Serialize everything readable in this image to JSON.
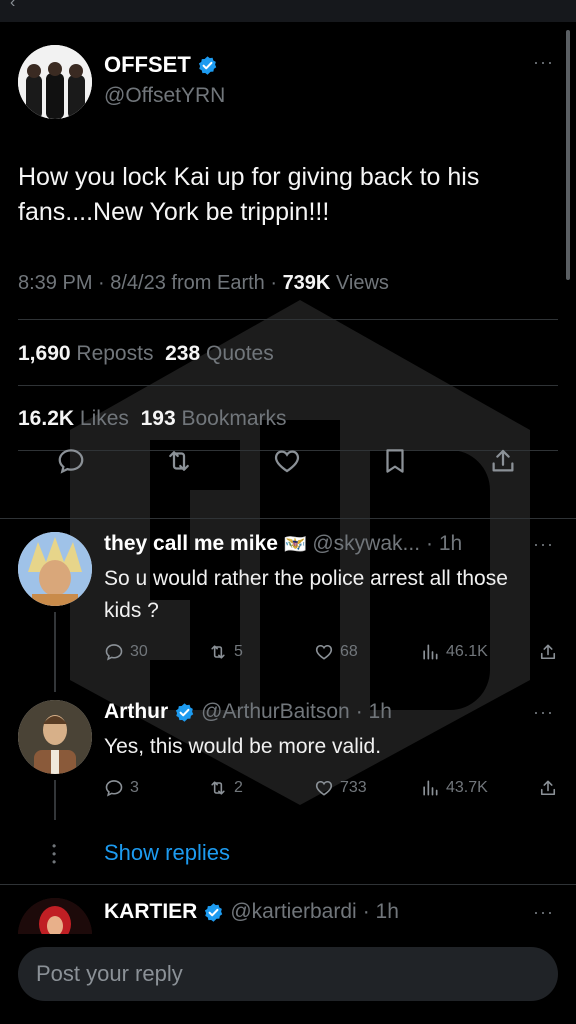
{
  "colors": {
    "background": "#000000",
    "accent": "#1d9bf0",
    "muted": "#71767b",
    "divider": "#2f3336"
  },
  "main_tweet": {
    "author_name": "OFFSET",
    "author_handle": "@OffsetYRN",
    "text": "How you lock Kai up for giving back to his fans....New York be trippin!!!",
    "time": "8:39 PM · 8/4/23 from Earth · ",
    "views_count": "739K",
    "views_label": "Views",
    "reposts_count": "1,690",
    "reposts_label": "Reposts",
    "quotes_count": "238",
    "quotes_label": "Quotes",
    "likes_count": "16.2K",
    "likes_label": "Likes",
    "bookmarks_count": "193",
    "bookmarks_label": "Bookmarks",
    "more": "···"
  },
  "replies": [
    {
      "name": "they call me mike",
      "flag": "🇻🇮",
      "handle": "@skywak...",
      "age": "· 1h",
      "text": "So u would rather the police  arrest all those kids  ?",
      "replies": "30",
      "reposts": "5",
      "likes": "68",
      "views": "46.1K"
    },
    {
      "name": "Arthur",
      "handle": "@ArthurBaitson",
      "age": "· 1h",
      "text": "Yes, this would be more valid.",
      "replies": "3",
      "reposts": "2",
      "likes": "733",
      "views": "43.7K"
    },
    {
      "name": "KARTIER",
      "handle": "@kartierbardi",
      "age": "· 1h"
    }
  ],
  "show_replies": "Show replies",
  "composer": {
    "placeholder": "Post your reply"
  },
  "icons": [
    "back-icon",
    "verified-icon",
    "reply-icon",
    "repost-icon",
    "like-icon",
    "bookmark-icon",
    "share-icon",
    "views-icon",
    "more-icon"
  ]
}
